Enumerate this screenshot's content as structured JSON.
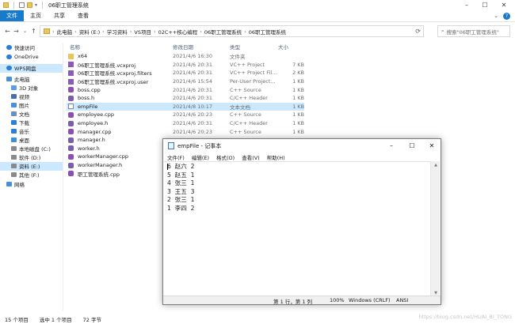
{
  "window": {
    "title": "06职工管理系统"
  },
  "ribbon": {
    "tabs": [
      "文件",
      "主页",
      "共享",
      "查看"
    ]
  },
  "address": {
    "crumbs": [
      "此电脑",
      "资料 (E:)",
      "学习资料",
      "VS项目",
      "02C++核心编程",
      "06职工管理系统",
      "06职工管理系统"
    ],
    "search_placeholder": "搜索\"06职工管理系统\""
  },
  "nav": {
    "items": [
      {
        "label": "快速访问",
        "icon": "star-icon",
        "indent": 0
      },
      {
        "label": "OneDrive",
        "icon": "cloud-icon",
        "indent": 0
      },
      {
        "label": "WPS网盘",
        "icon": "cloud-icon",
        "indent": 0,
        "selected": true
      },
      {
        "label": "此电脑",
        "icon": "computer-icon",
        "indent": 0
      },
      {
        "label": "3D 对象",
        "icon": "cube-icon",
        "indent": 1
      },
      {
        "label": "视频",
        "icon": "video-icon",
        "indent": 1
      },
      {
        "label": "图片",
        "icon": "picture-icon",
        "indent": 1
      },
      {
        "label": "文档",
        "icon": "document-icon",
        "indent": 1
      },
      {
        "label": "下载",
        "icon": "download-icon",
        "indent": 1
      },
      {
        "label": "音乐",
        "icon": "music-icon",
        "indent": 1
      },
      {
        "label": "桌面",
        "icon": "desktop-icon",
        "indent": 1
      },
      {
        "label": "本地磁盘 (C:)",
        "icon": "drive-icon",
        "indent": 1
      },
      {
        "label": "软件 (D:)",
        "icon": "drive-icon",
        "indent": 1
      },
      {
        "label": "资料 (E:)",
        "icon": "drive-icon",
        "indent": 1,
        "selected": true
      },
      {
        "label": "其他 (F:)",
        "icon": "drive-icon",
        "indent": 1
      },
      {
        "label": "网络",
        "icon": "network-icon",
        "indent": 0
      }
    ]
  },
  "columns": {
    "name": "名称",
    "date": "修改日期",
    "type": "类型",
    "size": "大小"
  },
  "files": [
    {
      "name": "x64",
      "date": "2021/4/6 16:30",
      "type": "文件夹",
      "size": "",
      "icon": "folder-icon"
    },
    {
      "name": "06职工管理系统.vcxproj",
      "date": "2021/4/6 20:31",
      "type": "VC++ Project",
      "size": "7 KB",
      "icon": "vcxproj-icon"
    },
    {
      "name": "06职工管理系统.vcxproj.filters",
      "date": "2021/4/6 20:31",
      "type": "VC++ Project Fil...",
      "size": "2 KB",
      "icon": "vcxproj-icon"
    },
    {
      "name": "06职工管理系统.vcxproj.user",
      "date": "2021/4/6 15:54",
      "type": "Per-User Project...",
      "size": "1 KB",
      "icon": "vcxproj-icon"
    },
    {
      "name": "boss.cpp",
      "date": "2021/4/6 20:31",
      "type": "C++ Source",
      "size": "1 KB",
      "icon": "cpp-file-icon"
    },
    {
      "name": "boss.h",
      "date": "2021/4/6 20:31",
      "type": "C/C++ Header",
      "size": "1 KB",
      "icon": "header-file-icon"
    },
    {
      "name": "empFile",
      "date": "2021/4/8 10:17",
      "type": "文本文档",
      "size": "1 KB",
      "icon": "text-file-icon",
      "selected": true
    },
    {
      "name": "employee.cpp",
      "date": "2021/4/6 20:23",
      "type": "C++ Source",
      "size": "1 KB",
      "icon": "cpp-file-icon"
    },
    {
      "name": "employee.h",
      "date": "2021/4/6 20:31",
      "type": "C/C++ Header",
      "size": "1 KB",
      "icon": "header-file-icon"
    },
    {
      "name": "manager.cpp",
      "date": "2021/4/6 20:23",
      "type": "C++ Source",
      "size": "1 KB",
      "icon": "cpp-file-icon"
    },
    {
      "name": "manager.h",
      "date": "",
      "type": "",
      "size": "",
      "icon": "header-file-icon"
    },
    {
      "name": "worker.h",
      "date": "",
      "type": "",
      "size": "",
      "icon": "header-file-icon"
    },
    {
      "name": "workerManager.cpp",
      "date": "",
      "type": "",
      "size": "",
      "icon": "cpp-file-icon"
    },
    {
      "name": "workerManager.h",
      "date": "",
      "type": "",
      "size": "",
      "icon": "header-file-icon"
    },
    {
      "name": "职工管理系统.cpp",
      "date": "",
      "type": "",
      "size": "",
      "icon": "cpp-file-icon"
    }
  ],
  "status": {
    "count": "15 个项目",
    "selection": "选中 1 个项目",
    "size": "72 字节"
  },
  "watermark": "https://blog.csdn.net/HUAI_BI_TONG",
  "notepad": {
    "title": "empFile - 记事本",
    "menu": [
      "文件(F)",
      "编辑(E)",
      "格式(O)",
      "查看(V)",
      "帮助(H)"
    ],
    "lines": [
      "6  赵六  2",
      "5  赵五  1",
      "4  张三  1",
      "3  王五  3",
      "2  张三  1",
      "1  李四  2"
    ],
    "status": {
      "position": "第 1 行，第 1 列",
      "zoom": "100%",
      "eol": "Windows (CRLF)",
      "encoding": "ANSI"
    }
  },
  "colors": {
    "accent": "#1979ca",
    "selection": "#cce8ff",
    "folder": "#e8c55d"
  }
}
